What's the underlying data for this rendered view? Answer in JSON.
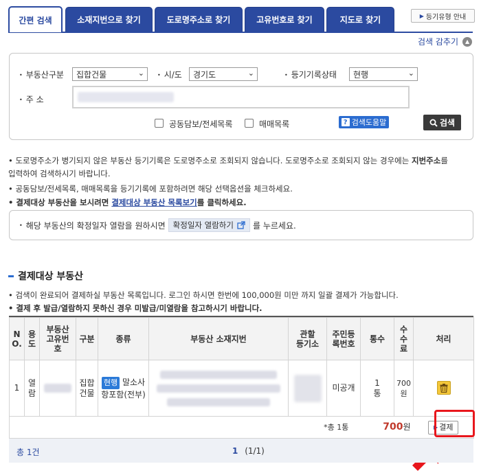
{
  "tabs": [
    "간편 검색",
    "소재지번으로 찾기",
    "도로명주소로 찾기",
    "고유번호로 찾기",
    "지도로 찾기"
  ],
  "register_type_button": "등기유형 안내",
  "fold_label": "검색 감추기",
  "search": {
    "property_type_label": "부동산구분",
    "property_type_value": "집합건물",
    "city_label": "시/도",
    "city_value": "경기도",
    "record_status_label": "등기기록상태",
    "record_status_value": "현행",
    "address_label": "주 소",
    "joint_collateral_label": "공동담보/전세목록",
    "sales_list_label": "매매목록",
    "help_button": "검색도움말",
    "search_button": "검색"
  },
  "notes": {
    "n1a": "도로명주소가 병기되지 않은 부동산 등기기록은 도로명주소로 조회되지 않습니다. 도로명주소로 조회되지 않는 경우에는 ",
    "n1b": "지번주소",
    "n1c": "를",
    "n1d": "입력하여 검색하시기 바랍니다.",
    "n2": "공동담보/전세목록, 매매목록을 등기기록에 포함하려면 해당 선택옵션을 체크하세요.",
    "n3a": "결제대상 부동산을 보시려면 ",
    "n3b": "결제대상 부동산 목록보기",
    "n3c": "를 클릭하세요."
  },
  "confirm_box": {
    "prefix": "해당 부동산의 확정일자 열람을 원하시면",
    "button": "확정일자 열람하기",
    "suffix": "를 누르세요."
  },
  "section": {
    "title": "결제대상 부동산",
    "note1": "검색이 완료되어 결제하실 부동산 목록입니다. 로그인 하시면 한번에 100,000원 미만 까지 일괄 결제가 가능합니다.",
    "note2": "결제 후 발급/열람하지 못하신 경우 미발급/미열람을 참고하시기 바랍니다."
  },
  "table": {
    "headers": [
      "N\nO.",
      "용\n도",
      "부동산\n고유번\n호",
      "구분",
      "종류",
      "부동산 소재지번",
      "관할\n등기소",
      "주민등\n록번호",
      "통수",
      "수\n수\n료",
      "처리"
    ],
    "row": {
      "no": "1",
      "use": "열\n람",
      "category": "집합\n건물",
      "badge": "현행",
      "kind": "말소사\n항포함(전부)",
      "resident_no": "미공개",
      "copies": "1\n통",
      "fee": "700\n원"
    },
    "summary_count": "*총 1통",
    "summary_amount": "700",
    "summary_unit": "원",
    "pay_button": "결제"
  },
  "footer": {
    "total": "총 1건",
    "page_current": "1",
    "page_info": "(1/1)"
  },
  "colors": {
    "brand_blue": "#2b4aa0",
    "accent_blue": "#2b6cd0",
    "amount_red": "#c0392b",
    "highlight_red": "#e8161c"
  }
}
